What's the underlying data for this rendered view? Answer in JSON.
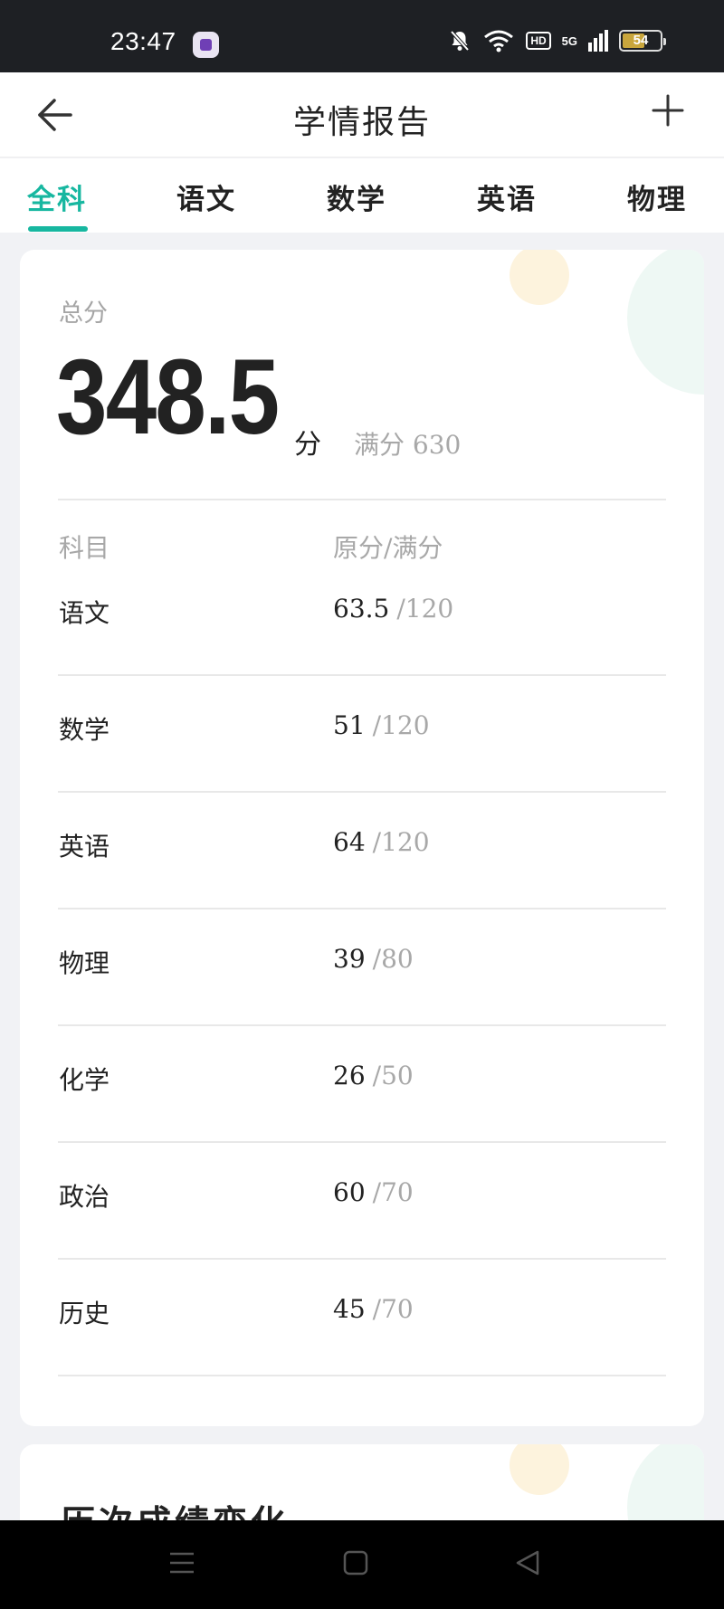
{
  "status_bar": {
    "time": "23:47",
    "network_label": "5G",
    "hd_label": "HD",
    "battery_level": "54"
  },
  "app_bar": {
    "title": "学情报告"
  },
  "tabs": [
    {
      "label": "全科",
      "active": true
    },
    {
      "label": "语文",
      "active": false
    },
    {
      "label": "数学",
      "active": false
    },
    {
      "label": "英语",
      "active": false
    },
    {
      "label": "物理",
      "active": false
    }
  ],
  "summary": {
    "total_label": "总分",
    "total_score": "348.5",
    "unit": "分",
    "full_mark": "满分 630"
  },
  "table": {
    "headers": [
      "科目",
      "原分/满分"
    ],
    "rows": [
      {
        "subject": "语文",
        "score": "63.5",
        "full": "/120"
      },
      {
        "subject": "数学",
        "score": "51",
        "full": "/120"
      },
      {
        "subject": "英语",
        "score": "64",
        "full": "/120"
      },
      {
        "subject": "物理",
        "score": "39",
        "full": "/80"
      },
      {
        "subject": "化学",
        "score": "26",
        "full": "/50"
      },
      {
        "subject": "政治",
        "score": "60",
        "full": "/70"
      },
      {
        "subject": "历史",
        "score": "45",
        "full": "/70"
      }
    ]
  },
  "history": {
    "title": "历次成绩变化"
  },
  "colors": {
    "accent": "#17b7a0",
    "text": "#222222",
    "muted": "#a8a8a8",
    "background": "#f1f2f5"
  },
  "icons": [
    "back-arrow-icon",
    "plus-icon",
    "notification-off-icon",
    "wifi-icon",
    "menu-icon",
    "home-icon",
    "back-triangle-icon"
  ]
}
